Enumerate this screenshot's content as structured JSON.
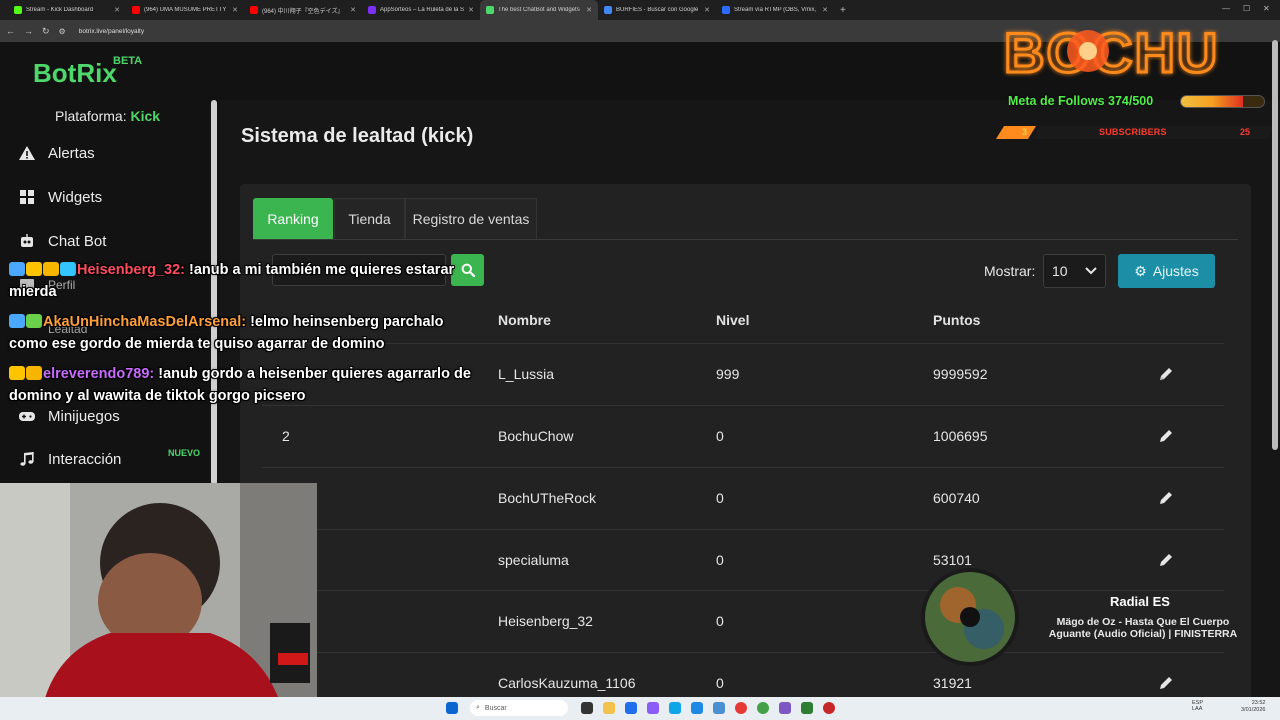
{
  "browser": {
    "tabs": [
      {
        "label": "Stream - Kick Dashboard",
        "color": "#53fc18"
      },
      {
        "label": "(964) UMA MUSUME PRETTY DERBY",
        "color": "#ff0000"
      },
      {
        "label": "(964) 中川翔子『空色デイズ』",
        "color": "#ff0000"
      },
      {
        "label": "AppSorteos – La Ruleta de la Suerte",
        "color": "#7b2ff7"
      },
      {
        "label": "The best ChatBot and Widgets",
        "color": "#4ed86b"
      },
      {
        "label": "BURFIES - Buscar con Google",
        "color": "#4285f4"
      },
      {
        "label": "Stream vía RTMP (OBS, Vmix, Zoom)",
        "color": "#2b6cff"
      }
    ],
    "new_tab_icon": "+",
    "url": "botrix.live/panel/loyalty"
  },
  "botrix": {
    "logo": "BotRix",
    "beta": "BETA",
    "platform_label": "Plataforma:",
    "platform_value": "Kick",
    "sidebar": {
      "alertas": "Alertas",
      "widgets": "Widgets",
      "chatbot": "Chat Bot",
      "perfil": "Perfil",
      "lealtad": "Lealtad",
      "minijuegos": "Minijuegos",
      "interaccion": "Interacción",
      "nuevo_badge": "NUEVO"
    },
    "page_title": "Sistema de lealtad (kick)",
    "tabs": {
      "ranking": "Ranking",
      "tienda": "Tienda",
      "registro": "Registro de ventas"
    },
    "mostrar_label": "Mostrar:",
    "mostrar_value": "10",
    "ajustes_label": "Ajustes",
    "table": {
      "headers": {
        "nombre": "Nombre",
        "nivel": "Nivel",
        "puntos": "Puntos"
      },
      "rows": [
        {
          "rank": "",
          "name": "L_Lussia",
          "level": "999",
          "points": "9999592"
        },
        {
          "rank": "2",
          "name": "BochuChow",
          "level": "0",
          "points": "1006695"
        },
        {
          "rank": "",
          "name": "BochUTheRock",
          "level": "0",
          "points": "600740"
        },
        {
          "rank": "",
          "name": "specialuma",
          "level": "0",
          "points": "53101"
        },
        {
          "rank": "",
          "name": "Heisenberg_32",
          "level": "0",
          "points": ""
        },
        {
          "rank": "",
          "name": "CarlosKauzuma_1106",
          "level": "0",
          "points": "31921"
        }
      ]
    }
  },
  "overlay": {
    "brand": "BOCHU",
    "follows_goal": "Meta de Follows 374/500",
    "follows_progress": 0.748,
    "subs_left": "3",
    "subs_label": "SUBSCRIBERS",
    "subs_right": "25",
    "chat": [
      {
        "user": "Heisenberg_32:",
        "text": " !anub a mi también me quieres estarar mierda"
      },
      {
        "user": "AkaUnHinchaMasDelArsenal:",
        "text": " !elmo heinsenberg parchalo como ese gordo de mierda te quiso agarrar de domino"
      },
      {
        "user": "elreverendo789:",
        "text": " !anub gordo a heisenber quieres agarrarlo de domino y al wawita de tiktok gorgo picsero"
      }
    ],
    "music": {
      "station": "Radial ES",
      "track_line1": "Mägo de Oz - Hasta Que El Cuerpo",
      "track_line2": "Aguante (Audio Oficial) | FINISTERRA"
    }
  },
  "taskbar": {
    "search_placeholder": "Buscar",
    "lang_line1": "ESP",
    "lang_line2": "LAA",
    "time": "23:52",
    "date": "3/01/2026"
  }
}
